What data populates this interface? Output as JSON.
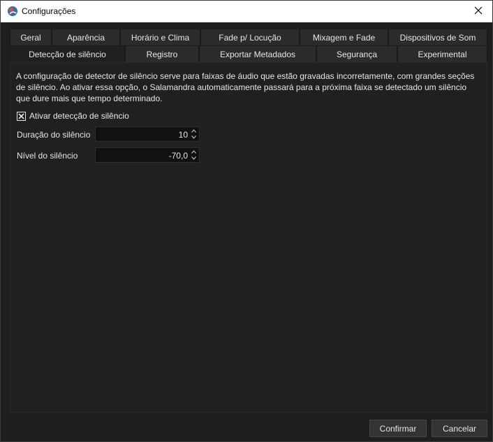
{
  "window": {
    "title": "Configurações",
    "app_icon": "salamandra-app-icon",
    "close_icon": "close-icon"
  },
  "tabs": {
    "row1": [
      "Geral",
      "Aparência",
      "Horário e Clima",
      "Fade p/ Locução",
      "Mixagem e Fade",
      "Dispositivos de Som"
    ],
    "row2": [
      "Detecção de silêncio",
      "Registro",
      "Exportar Metadados",
      "Segurança",
      "Experimental"
    ],
    "active": "Detecção de silêncio"
  },
  "panel": {
    "description": "A configuração de detector de silêncio serve para faixas de áudio que estão gravadas incorretamente, com grandes seções de silêncio. Ao ativar essa opção, o Salamandra automaticamente passará para a próxima faixa se detectado um silêncio que dure mais que tempo determinado.",
    "enable_checkbox": {
      "label": "Ativar detecção de silêncio",
      "checked": true
    },
    "duration": {
      "label": "Duração do silêncio",
      "value": "10"
    },
    "level": {
      "label": "Nível do silêncio",
      "value": "-70,0"
    }
  },
  "buttons": {
    "confirm": "Confirmar",
    "cancel": "Cancelar"
  },
  "colors": {
    "background": "#1e1e1e",
    "titlebar": "#ffffff",
    "tab": "#2b2b2b",
    "input": "#111111",
    "text": "#e6e6e6"
  }
}
